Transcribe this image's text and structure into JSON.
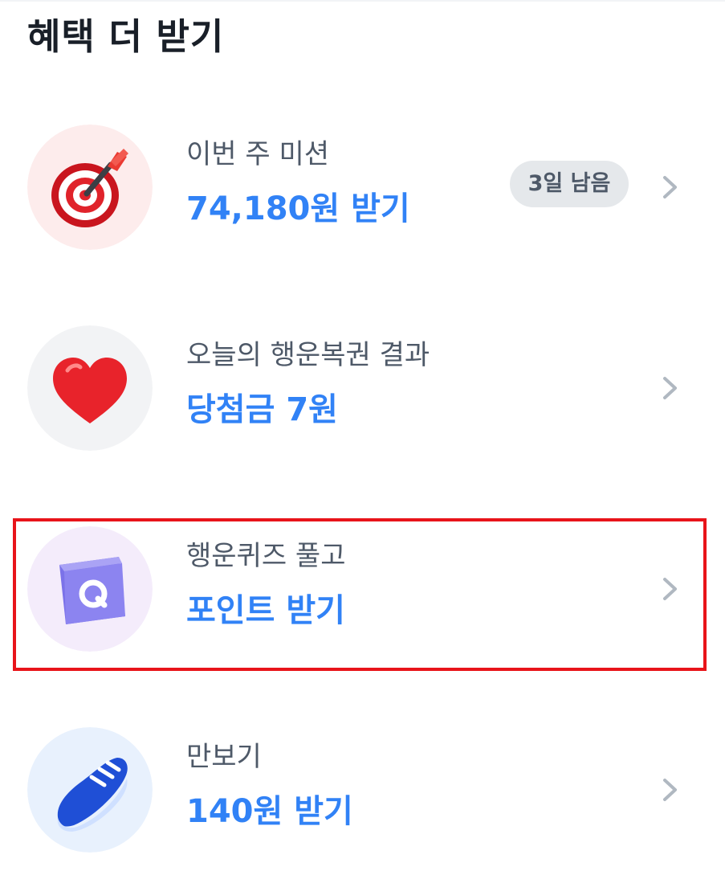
{
  "header": {
    "title": "혜택 더 받기"
  },
  "items": [
    {
      "subtitle": "이번 주 미션",
      "title": "74,180원 받기",
      "badge": "3일 남음",
      "icon": "dartboard-icon",
      "icon_bg": "#fdecec"
    },
    {
      "subtitle": "오늘의 행운복권 결과",
      "title": "당첨금 7원",
      "icon": "heart-icon",
      "icon_bg": "#f2f3f5"
    },
    {
      "subtitle": "행운퀴즈 풀고",
      "title": "포인트 받기",
      "icon": "quiz-cube-icon",
      "icon_bg": "#f4ecfb",
      "highlighted": true
    },
    {
      "subtitle": "만보기",
      "title": "140원 받기",
      "icon": "sneaker-icon",
      "icon_bg": "#e8f1fd"
    }
  ],
  "colors": {
    "accent": "#3182f6",
    "title": "#191f28",
    "subtitle": "#4e5968",
    "highlight": "#e8141a"
  }
}
